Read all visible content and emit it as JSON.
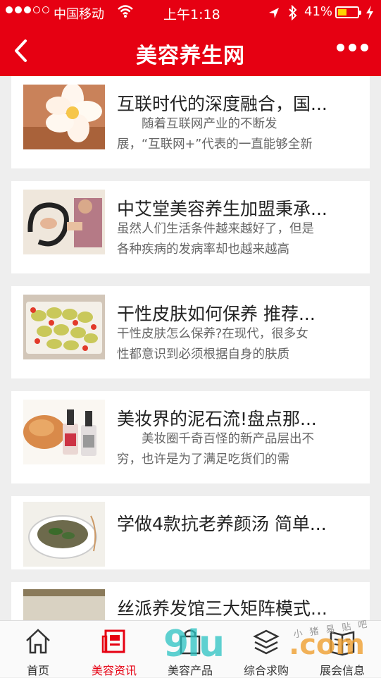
{
  "status_bar": {
    "carrier": "中国移动",
    "time": "上午1:18",
    "battery": "41%",
    "signal_bars": 3,
    "battery_level": 0.41
  },
  "header": {
    "title": "美容养生网"
  },
  "articles": [
    {
      "title": "互联时代的深度融合，国...",
      "summary_line1": "　　随着互联网产业的不断发",
      "summary_line2": "展，“互联网+”代表的一直能够全新"
    },
    {
      "title": "中艾堂美容养生加盟秉承...",
      "summary_line1": "虽然人们生活条件越来越好了，但是",
      "summary_line2": "各种疾病的发病率却也越来越高"
    },
    {
      "title": "干性皮肤如何保养 推荐...",
      "summary_line1": "干性皮肤怎么保养?在现代，很多女",
      "summary_line2": "性都意识到必须根据自身的肤质"
    },
    {
      "title": "美妆界的泥石流!盘点那...",
      "summary_line1": "　　美妆圈千奇百怪的新产品层出不",
      "summary_line2": "穷，也许是为了满足吃货们的需"
    },
    {
      "title": "学做4款抗老养颜汤 简单...",
      "summary_line1": "",
      "summary_line2": ""
    },
    {
      "title": "丝派养发馆三大矩阵模式...",
      "summary_line1": "",
      "summary_line2": ""
    }
  ],
  "tabbar": {
    "items": [
      {
        "label": "首页",
        "icon": "home-icon"
      },
      {
        "label": "美容资讯",
        "icon": "news-icon"
      },
      {
        "label": "美容产品",
        "icon": "bag-icon"
      },
      {
        "label": "综合求购",
        "icon": "layers-icon"
      },
      {
        "label": "展会信息",
        "icon": "book-icon"
      }
    ],
    "active_index": 1
  },
  "watermark": {
    "text": "9lu",
    "text2": ".com",
    "small": "小 猪 易 贴 吧"
  },
  "colors": {
    "brand_red": "#e60012",
    "text_dark": "#222222",
    "text_gray": "#666666"
  }
}
